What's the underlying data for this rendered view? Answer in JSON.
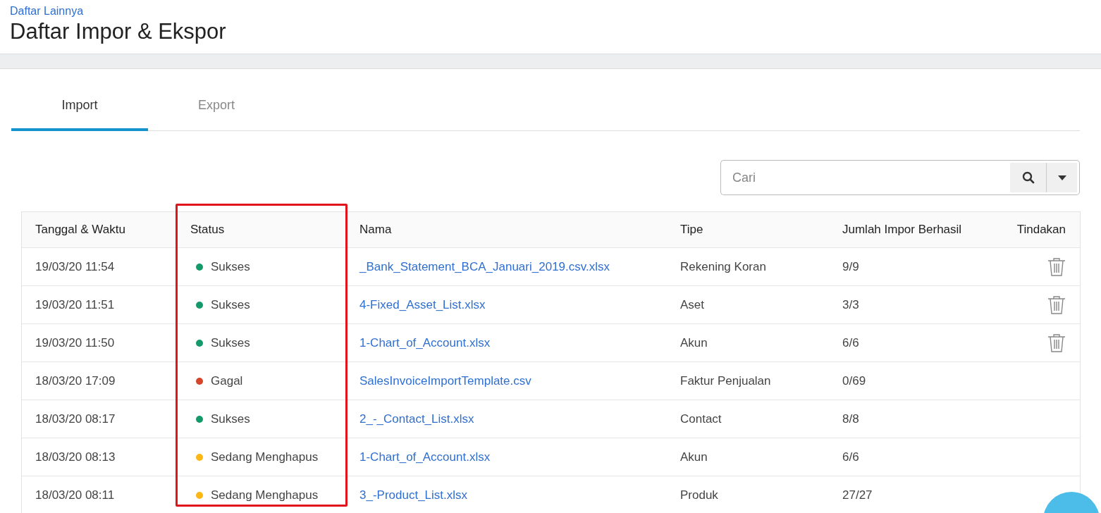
{
  "breadcrumb": "Daftar Lainnya",
  "title": "Daftar Impor & Ekspor",
  "tabs": [
    {
      "label": "Import",
      "selected": true
    },
    {
      "label": "Export",
      "selected": false
    }
  ],
  "search": {
    "placeholder": "Cari"
  },
  "table": {
    "columns": [
      {
        "label": "Tanggal & Waktu",
        "highlighted": false
      },
      {
        "label": "Status",
        "highlighted": true
      },
      {
        "label": "Nama",
        "highlighted": false
      },
      {
        "label": "Tipe",
        "highlighted": false
      },
      {
        "label": "Jumlah Impor Berhasil",
        "highlighted": false
      },
      {
        "label": "Tindakan",
        "highlighted": false
      }
    ],
    "rows": [
      {
        "datetime": "19/03/20 11:54",
        "status": "Sukses",
        "color": "#14996a",
        "name": "_Bank_Statement_BCA_Januari_2019.csv.xlsx",
        "type": "Rekening Koran",
        "count": "9/9",
        "deletable": true
      },
      {
        "datetime": "19/03/20 11:51",
        "status": "Sukses",
        "color": "#14996a",
        "name": "4-Fixed_Asset_List.xlsx",
        "type": "Aset",
        "count": "3/3",
        "deletable": true
      },
      {
        "datetime": "19/03/20 11:50",
        "status": "Sukses",
        "color": "#14996a",
        "name": "1-Chart_of_Account.xlsx",
        "type": "Akun",
        "count": "6/6",
        "deletable": true
      },
      {
        "datetime": "18/03/20 17:09",
        "status": "Gagal",
        "color": "#d4452a",
        "name": "SalesInvoiceImportTemplate.csv",
        "type": "Faktur Penjualan",
        "count": "0/69",
        "deletable": false
      },
      {
        "datetime": "18/03/20 08:17",
        "status": "Sukses",
        "color": "#14996a",
        "name": "2_-_Contact_List.xlsx",
        "type": "Contact",
        "count": "8/8",
        "deletable": false
      },
      {
        "datetime": "18/03/20 08:13",
        "status": "Sedang Menghapus",
        "color": "#fbb713",
        "name": "1-Chart_of_Account.xlsx",
        "type": "Akun",
        "count": "6/6",
        "deletable": false
      },
      {
        "datetime": "18/03/20 08:11",
        "status": "Sedang Menghapus",
        "color": "#fbb713",
        "name": "3_-Product_List.xlsx",
        "type": "Produk",
        "count": "27/27",
        "deletable": false
      }
    ]
  }
}
